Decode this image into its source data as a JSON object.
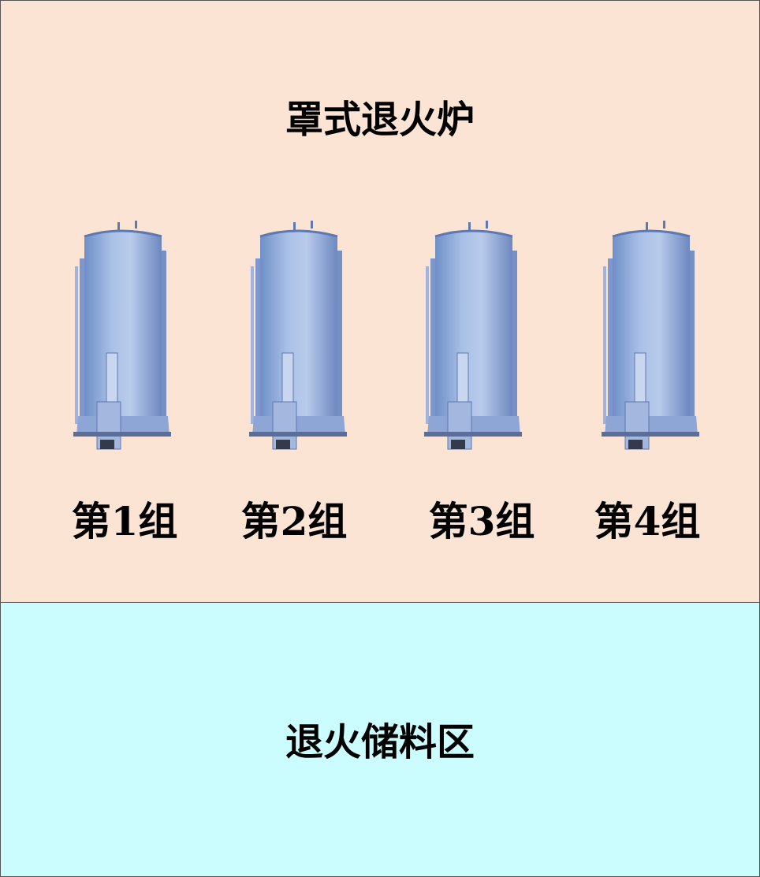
{
  "annealing_furnace_zone": {
    "title": "罩式退火炉",
    "groups": [
      {
        "label": "第1组"
      },
      {
        "label": "第2组"
      },
      {
        "label": "第3组"
      },
      {
        "label": "第4组"
      }
    ],
    "background_color": "#fce4d4"
  },
  "annealing_storage_zone": {
    "title": "退火储料区",
    "background_color": "#ccfdfe"
  }
}
